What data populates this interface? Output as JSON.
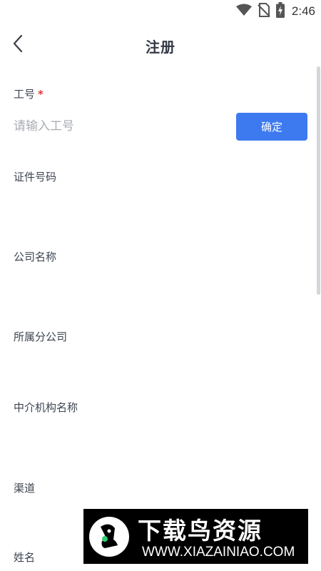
{
  "status_bar": {
    "time": "2:46",
    "icons": [
      "wifi-icon",
      "no-sim-icon",
      "battery-charging-icon"
    ]
  },
  "header": {
    "title": "注册",
    "back_icon": "chevron-left-icon"
  },
  "form": {
    "employee_id": {
      "label": "工号",
      "required_mark": "*",
      "placeholder": "请输入工号",
      "value": ""
    },
    "confirm_button_label": "确定",
    "fields": [
      {
        "label": "证件号码"
      },
      {
        "label": "公司名称"
      },
      {
        "label": "所属分公司"
      },
      {
        "label": "中介机构名称"
      },
      {
        "label": "渠道"
      },
      {
        "label": "姓名"
      }
    ]
  },
  "watermark": {
    "title": "下载鸟资源",
    "url": "WWW.XIAZAINIAO.COM"
  },
  "colors": {
    "accent": "#3d7af0",
    "required": "#e0393e",
    "text": "#3d4450",
    "placeholder": "#a8acb3"
  }
}
